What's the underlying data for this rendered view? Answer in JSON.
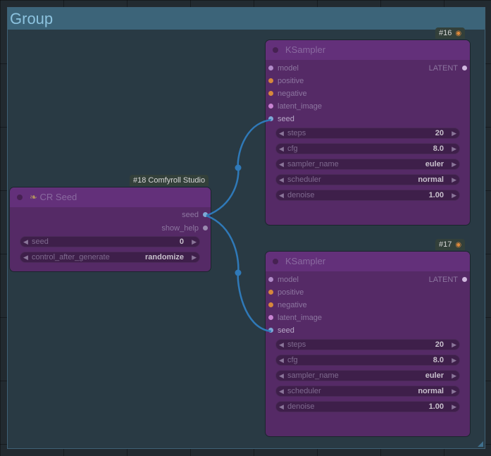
{
  "group": {
    "title": "Group"
  },
  "cr_seed": {
    "badge": "#18 Comfyroll Studio",
    "icon": "seedling-icon",
    "title": "CR Seed",
    "outputs": [
      "seed",
      "show_help"
    ],
    "widgets": [
      {
        "name": "seed",
        "value": "0"
      },
      {
        "name": "control_after_generate",
        "value": "randomize"
      }
    ]
  },
  "ksampler_16": {
    "badge": "#16",
    "title": "KSampler",
    "inputs": [
      "model",
      "positive",
      "negative",
      "latent_image",
      "seed"
    ],
    "output": "LATENT",
    "widgets": [
      {
        "name": "steps",
        "value": "20"
      },
      {
        "name": "cfg",
        "value": "8.0"
      },
      {
        "name": "sampler_name",
        "value": "euler"
      },
      {
        "name": "scheduler",
        "value": "normal"
      },
      {
        "name": "denoise",
        "value": "1.00"
      }
    ]
  },
  "ksampler_17": {
    "badge": "#17",
    "title": "KSampler",
    "inputs": [
      "model",
      "positive",
      "negative",
      "latent_image",
      "seed"
    ],
    "output": "LATENT",
    "widgets": [
      {
        "name": "steps",
        "value": "20"
      },
      {
        "name": "cfg",
        "value": "8.0"
      },
      {
        "name": "sampler_name",
        "value": "euler"
      },
      {
        "name": "scheduler",
        "value": "normal"
      },
      {
        "name": "denoise",
        "value": "1.00"
      }
    ]
  },
  "colors": {
    "model": "#b08ac8",
    "positive": "#d6883c",
    "negative": "#d6883c",
    "latent_image": "#c883d2",
    "seed": "#7fa8d6",
    "latent_out": "#d0b8de",
    "show_help": "#9a8ab0",
    "link": "#2f79b8"
  }
}
